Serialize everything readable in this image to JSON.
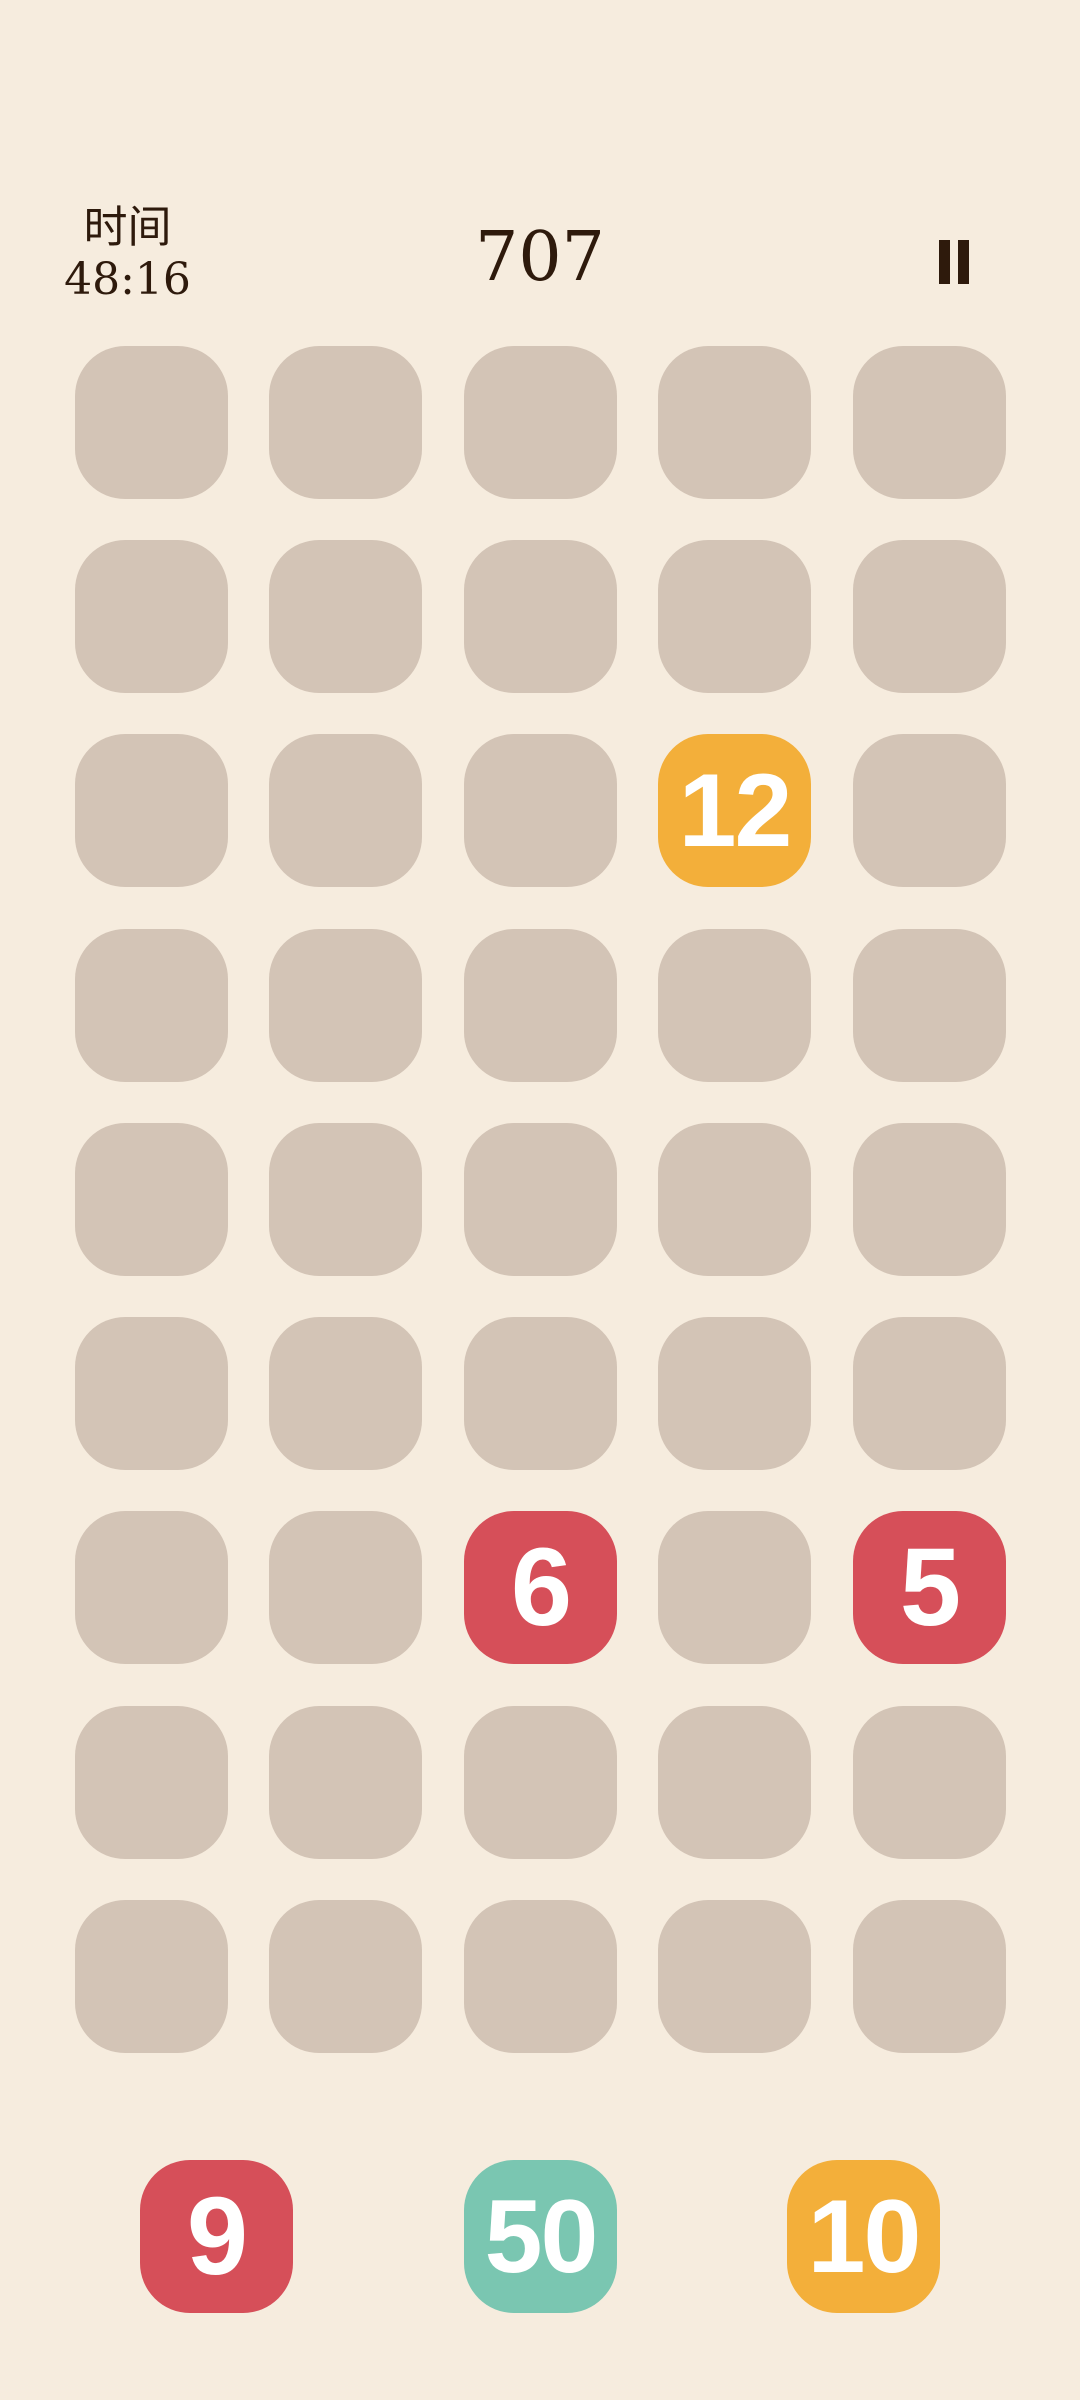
{
  "hud": {
    "time_label": "时间",
    "time_value": "48:16",
    "score": "707",
    "pause_icon": "pause-icon"
  },
  "colors": {
    "background": "#F6ECDE",
    "empty_cell": "#D3C4B6",
    "text_dark": "#2E1A0C",
    "red": "#D64F59",
    "orange": "#F3AF3A",
    "teal": "#7AC6B1"
  },
  "board": {
    "rows": 9,
    "cols": 5,
    "tiles": [
      {
        "row": 2,
        "col": 3,
        "value": "12",
        "color": "#F3AF3A"
      },
      {
        "row": 6,
        "col": 2,
        "value": "6",
        "color": "#D64F59"
      },
      {
        "row": 6,
        "col": 4,
        "value": "5",
        "color": "#D64F59"
      }
    ]
  },
  "tray": [
    {
      "value": "9",
      "color": "#D64F59"
    },
    {
      "value": "50",
      "color": "#7AC6B1"
    },
    {
      "value": "10",
      "color": "#F3AF3A"
    }
  ]
}
